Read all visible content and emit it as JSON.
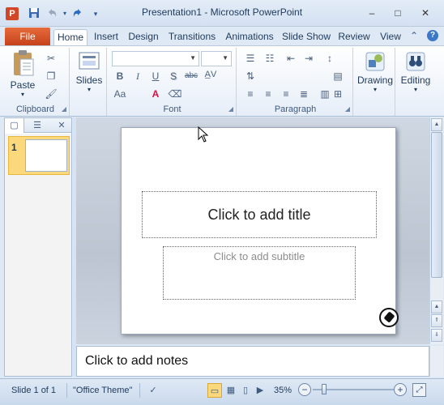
{
  "titlebar": {
    "app_icon_letter": "P",
    "title": "Presentation1 - Microsoft PowerPoint",
    "qat": {
      "save_icon": "save-icon",
      "undo_icon": "undo-icon",
      "redo_icon": "redo-icon",
      "customize_icon": "chevron-down-icon"
    },
    "window_buttons": {
      "minimize": "–",
      "maximize": "□",
      "close": "✕"
    }
  },
  "ribbon_tabs": {
    "file": "File",
    "tabs": [
      "Home",
      "Insert",
      "Design",
      "Transitions",
      "Animations",
      "Slide Show",
      "Review",
      "View"
    ],
    "active": "Home"
  },
  "ribbon": {
    "clipboard": {
      "label": "Clipboard",
      "paste": "Paste"
    },
    "slides": {
      "label": "Slides",
      "button": "Slides"
    },
    "font": {
      "label": "Font",
      "font_name": "",
      "font_size": ""
    },
    "paragraph": {
      "label": "Paragraph"
    },
    "drawing": {
      "button": "Drawing"
    },
    "editing": {
      "button": "Editing"
    }
  },
  "left_pane": {
    "slide_number": "1"
  },
  "slide": {
    "title_placeholder": "Click to add title",
    "subtitle_placeholder": "Click to add subtitle"
  },
  "notes": {
    "placeholder": "Click to add notes"
  },
  "statusbar": {
    "slide_info": "Slide 1 of 1",
    "theme": "\"Office Theme\"",
    "zoom": "35%",
    "zoom_level": 0.35
  },
  "colors": {
    "file_tab": "#d24726",
    "selection": "#fbd87c",
    "ribbon_text": "#1e395b"
  }
}
